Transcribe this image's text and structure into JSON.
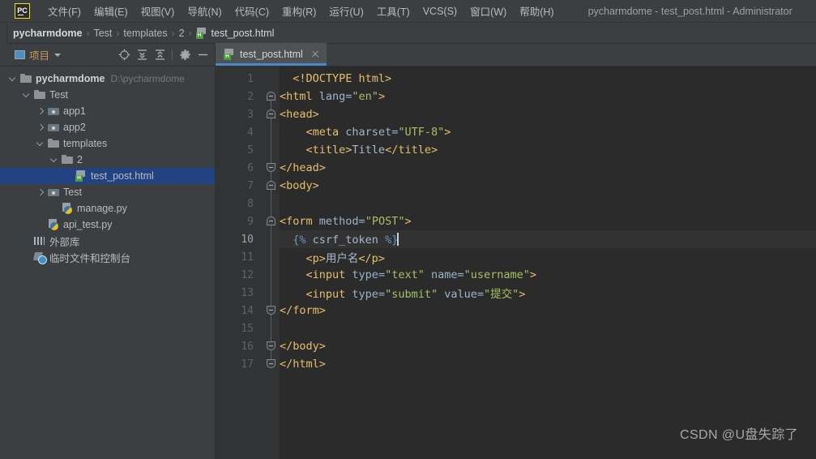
{
  "titlebar": {
    "logo": "pycharm-logo",
    "menus": [
      {
        "label": "文件(F)",
        "name": "menu-file"
      },
      {
        "label": "编辑(E)",
        "name": "menu-edit"
      },
      {
        "label": "视图(V)",
        "name": "menu-view"
      },
      {
        "label": "导航(N)",
        "name": "menu-navigate"
      },
      {
        "label": "代码(C)",
        "name": "menu-code"
      },
      {
        "label": "重构(R)",
        "name": "menu-refactor"
      },
      {
        "label": "运行(U)",
        "name": "menu-run"
      },
      {
        "label": "工具(T)",
        "name": "menu-tools"
      },
      {
        "label": "VCS(S)",
        "name": "menu-vcs"
      },
      {
        "label": "窗口(W)",
        "name": "menu-window"
      },
      {
        "label": "帮助(H)",
        "name": "menu-help"
      }
    ],
    "window_title": "pycharmdome - test_post.html - Administrator"
  },
  "breadcrumb": {
    "items": [
      "pycharmdome",
      "Test",
      "templates",
      "2"
    ],
    "separator": "›",
    "file": "test_post.html"
  },
  "project_panel": {
    "title": "项目",
    "toolbar_icons": [
      "locate-icon",
      "expand-all-icon",
      "collapse-all-icon",
      "settings-gear-icon",
      "hide-icon"
    ],
    "tree": [
      {
        "label": "pycharmdome",
        "path": "D:\\pycharmdome",
        "icon": "folder-icon",
        "arrow": "down",
        "indent": 0,
        "bold": true,
        "selected": false
      },
      {
        "label": "Test",
        "path": "",
        "icon": "folder-icon",
        "arrow": "down",
        "indent": 1,
        "bold": false,
        "selected": false
      },
      {
        "label": "app1",
        "path": "",
        "icon": "module-folder-icon",
        "arrow": "right",
        "indent": 2,
        "bold": false,
        "selected": false
      },
      {
        "label": "app2",
        "path": "",
        "icon": "module-folder-icon",
        "arrow": "right",
        "indent": 2,
        "bold": false,
        "selected": false
      },
      {
        "label": "templates",
        "path": "",
        "icon": "folder-icon",
        "arrow": "down",
        "indent": 2,
        "bold": false,
        "selected": false
      },
      {
        "label": "2",
        "path": "",
        "icon": "folder-icon",
        "arrow": "down",
        "indent": 3,
        "bold": false,
        "selected": false
      },
      {
        "label": "test_post.html",
        "path": "",
        "icon": "html-file-icon",
        "arrow": "none",
        "indent": 4,
        "bold": false,
        "selected": true
      },
      {
        "label": "Test",
        "path": "",
        "icon": "module-folder-icon",
        "arrow": "right",
        "indent": 2,
        "bold": false,
        "selected": false
      },
      {
        "label": "manage.py",
        "path": "",
        "icon": "python-file-icon",
        "arrow": "none",
        "indent": 3,
        "bold": false,
        "selected": false
      },
      {
        "label": "api_test.py",
        "path": "",
        "icon": "python-file-icon",
        "arrow": "none",
        "indent": 2,
        "bold": false,
        "selected": false
      },
      {
        "label": "外部库",
        "path": "",
        "icon": "external-libraries-icon",
        "arrow": "none",
        "indent": 1,
        "bold": false,
        "selected": false
      },
      {
        "label": "临时文件和控制台",
        "path": "",
        "icon": "scratches-icon",
        "arrow": "none",
        "indent": 1,
        "bold": false,
        "selected": false
      }
    ]
  },
  "editor": {
    "tab": {
      "label": "test_post.html",
      "icon": "html-file-icon",
      "active": true
    },
    "caret_line": 10,
    "lines": [
      {
        "n": 1,
        "fold": "none",
        "indent": 1,
        "tokens": [
          {
            "t": "tag",
            "v": "<!DOCTYPE html>"
          }
        ]
      },
      {
        "n": 2,
        "fold": "start",
        "indent": 0,
        "tokens": [
          {
            "t": "tag",
            "v": "<html "
          },
          {
            "t": "attr",
            "v": "lang="
          },
          {
            "t": "val",
            "v": "\"en\""
          },
          {
            "t": "tag",
            "v": ">"
          }
        ]
      },
      {
        "n": 3,
        "fold": "start",
        "indent": 0,
        "tokens": [
          {
            "t": "tag",
            "v": "<head>"
          }
        ]
      },
      {
        "n": 4,
        "fold": "none",
        "indent": 2,
        "tokens": [
          {
            "t": "tag",
            "v": "<meta "
          },
          {
            "t": "attr",
            "v": "charset="
          },
          {
            "t": "val",
            "v": "\"UTF-8\""
          },
          {
            "t": "tag",
            "v": ">"
          }
        ]
      },
      {
        "n": 5,
        "fold": "none",
        "indent": 2,
        "tokens": [
          {
            "t": "tag",
            "v": "<title>"
          },
          {
            "t": "text",
            "v": "Title"
          },
          {
            "t": "tag",
            "v": "</title>"
          }
        ]
      },
      {
        "n": 6,
        "fold": "end",
        "indent": 0,
        "tokens": [
          {
            "t": "tag",
            "v": "</head>"
          }
        ]
      },
      {
        "n": 7,
        "fold": "start",
        "indent": 0,
        "tokens": [
          {
            "t": "tag",
            "v": "<body>"
          }
        ]
      },
      {
        "n": 8,
        "fold": "none",
        "indent": 0,
        "tokens": []
      },
      {
        "n": 9,
        "fold": "start",
        "indent": 0,
        "tokens": [
          {
            "t": "tag",
            "v": "<form "
          },
          {
            "t": "attr",
            "v": "method="
          },
          {
            "t": "val",
            "v": "\"POST\""
          },
          {
            "t": "tag",
            "v": ">"
          }
        ]
      },
      {
        "n": 10,
        "fold": "none",
        "indent": 1,
        "tokens": [
          {
            "t": "brace",
            "v": "{%"
          },
          {
            "t": "dj",
            "v": " csrf_token "
          },
          {
            "t": "brace",
            "v": "%}"
          }
        ],
        "caret": true
      },
      {
        "n": 11,
        "fold": "none",
        "indent": 2,
        "tokens": [
          {
            "t": "tag",
            "v": "<p>"
          },
          {
            "t": "text",
            "v": "用户名"
          },
          {
            "t": "tag",
            "v": "</p>"
          }
        ]
      },
      {
        "n": 12,
        "fold": "none",
        "indent": 2,
        "tokens": [
          {
            "t": "tag",
            "v": "<input "
          },
          {
            "t": "attr",
            "v": "type="
          },
          {
            "t": "val",
            "v": "\"text\""
          },
          {
            "t": "attr",
            "v": " name="
          },
          {
            "t": "val",
            "v": "\"username\""
          },
          {
            "t": "tag",
            "v": ">"
          }
        ]
      },
      {
        "n": 13,
        "fold": "none",
        "indent": 2,
        "tokens": [
          {
            "t": "tag",
            "v": "<input "
          },
          {
            "t": "attr",
            "v": "type="
          },
          {
            "t": "val",
            "v": "\"submit\""
          },
          {
            "t": "attr",
            "v": " value="
          },
          {
            "t": "val",
            "v": "\"提交\""
          },
          {
            "t": "tag",
            "v": ">"
          }
        ]
      },
      {
        "n": 14,
        "fold": "end",
        "indent": 0,
        "tokens": [
          {
            "t": "tag",
            "v": "</form>"
          }
        ]
      },
      {
        "n": 15,
        "fold": "none",
        "indent": 0,
        "tokens": []
      },
      {
        "n": 16,
        "fold": "end",
        "indent": 0,
        "tokens": [
          {
            "t": "tag",
            "v": "</body>"
          }
        ]
      },
      {
        "n": 17,
        "fold": "end",
        "indent": 0,
        "tokens": [
          {
            "t": "tag",
            "v": "</html>"
          }
        ]
      }
    ]
  },
  "watermark": "CSDN @U盘失踪了",
  "colors": {
    "panel_bg": "#3c3f41",
    "editor_bg": "#2b2b2b",
    "gutter_bg": "#313335",
    "selection_blue": "#214283",
    "tab_accent": "#4a88c7",
    "tag": "#e8bf6a",
    "attr_value": "#a5c261",
    "django_brace": "#6897bb",
    "text": "#a9b7c6"
  }
}
